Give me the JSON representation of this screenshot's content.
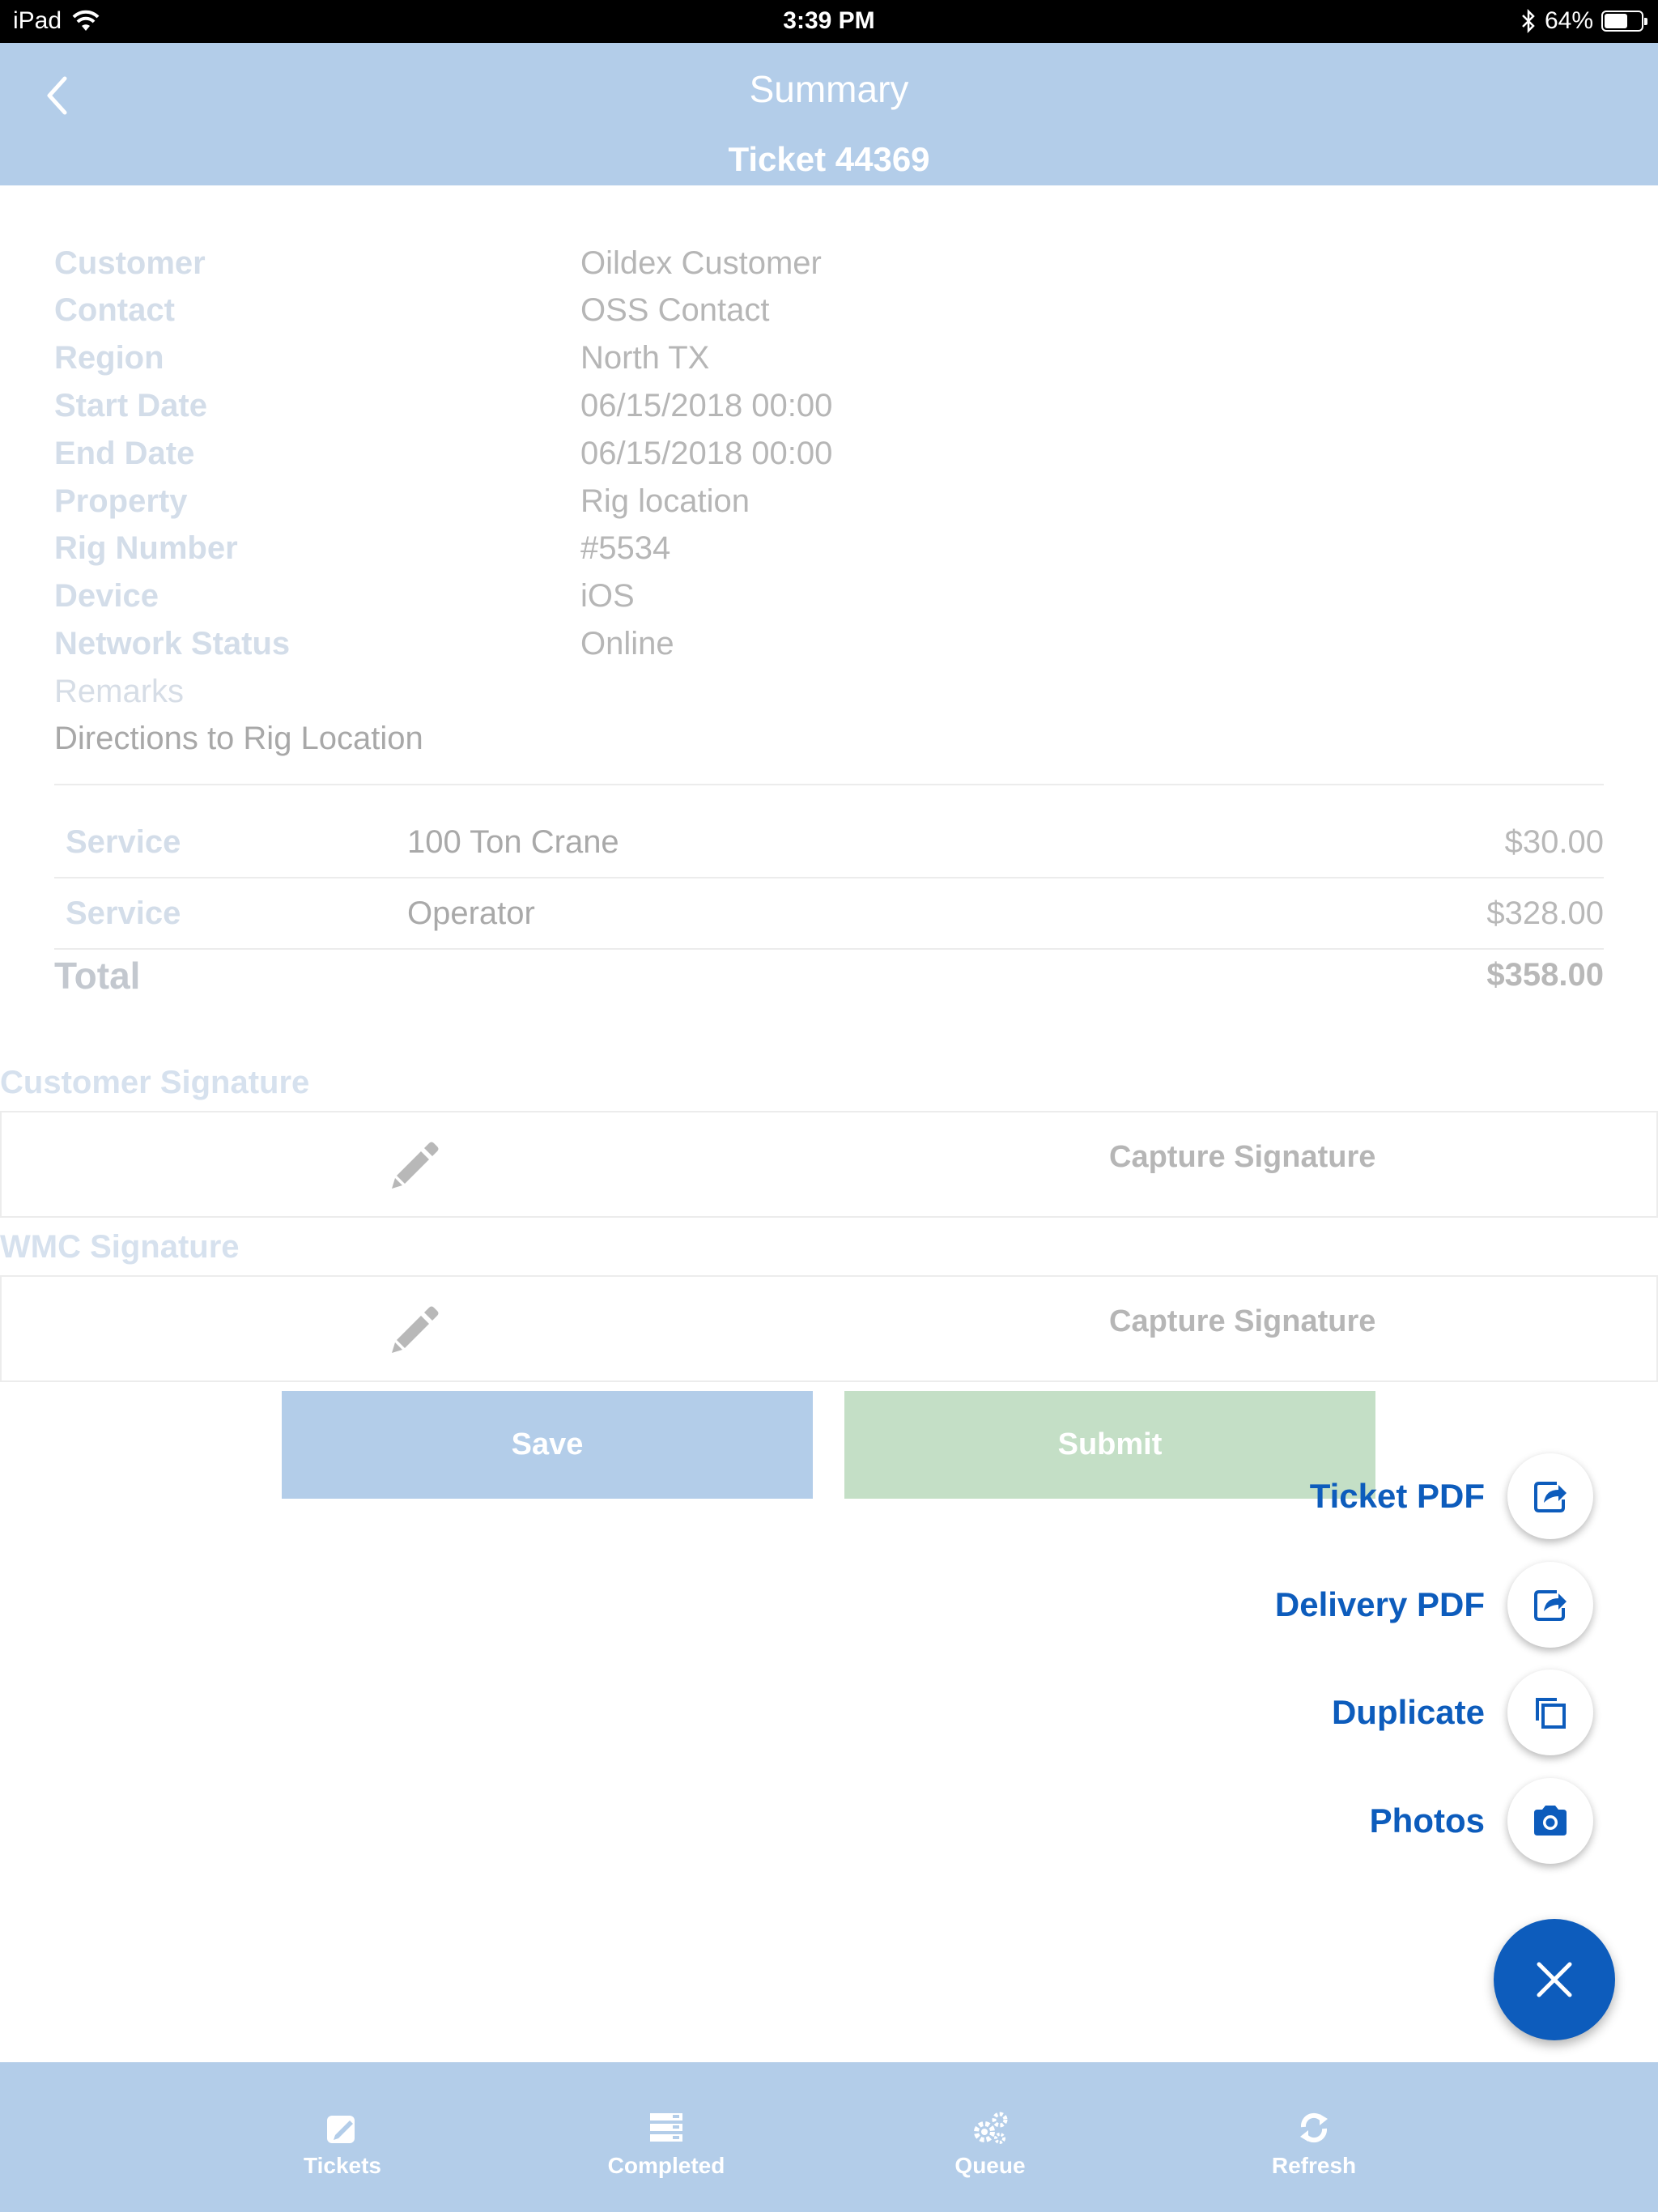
{
  "status_bar": {
    "device": "iPad",
    "time": "3:39 PM",
    "battery": "64%",
    "battery_level": 0.64
  },
  "header": {
    "title": "Summary",
    "subtitle": "Ticket 44369"
  },
  "details": [
    {
      "label": "Customer",
      "value": "Oildex Customer"
    },
    {
      "label": "Contact",
      "value": "OSS Contact"
    },
    {
      "label": "Region",
      "value": "North TX"
    },
    {
      "label": "Start Date",
      "value": "06/15/2018 00:00"
    },
    {
      "label": "End Date",
      "value": "06/15/2018 00:00"
    },
    {
      "label": "Property",
      "value": "Rig location"
    },
    {
      "label": "Rig Number",
      "value": "#5534"
    },
    {
      "label": "Device",
      "value": "iOS"
    },
    {
      "label": "Network Status",
      "value": "Online"
    }
  ],
  "remarks": {
    "label": "Remarks",
    "value": "Directions to Rig Location"
  },
  "services": [
    {
      "type": "Service",
      "name": "100 Ton Crane",
      "price": "$30.00"
    },
    {
      "type": "Service",
      "name": "Operator",
      "price": "$328.00"
    }
  ],
  "total": {
    "label": "Total",
    "value": "$358.00"
  },
  "signatures": {
    "customer": {
      "heading": "Customer Signature",
      "action": "Capture Signature"
    },
    "wmc": {
      "heading": "WMC Signature",
      "action": "Capture Signature"
    }
  },
  "buttons": {
    "save": "Save",
    "submit": "Submit"
  },
  "speed_dial": [
    {
      "label": "Ticket PDF",
      "icon": "share-icon"
    },
    {
      "label": "Delivery PDF",
      "icon": "share-icon"
    },
    {
      "label": "Duplicate",
      "icon": "duplicate-icon"
    },
    {
      "label": "Photos",
      "icon": "camera-icon"
    }
  ],
  "tabs": [
    {
      "label": "Tickets",
      "icon": "edit-icon"
    },
    {
      "label": "Completed",
      "icon": "list-icon"
    },
    {
      "label": "Queue",
      "icon": "gears-icon"
    },
    {
      "label": "Refresh",
      "icon": "refresh-icon"
    }
  ],
  "colors": {
    "header_bg": "#b3cde9",
    "accent_blue": "#0d5cbc",
    "submit_green": "#c4dfc6"
  }
}
